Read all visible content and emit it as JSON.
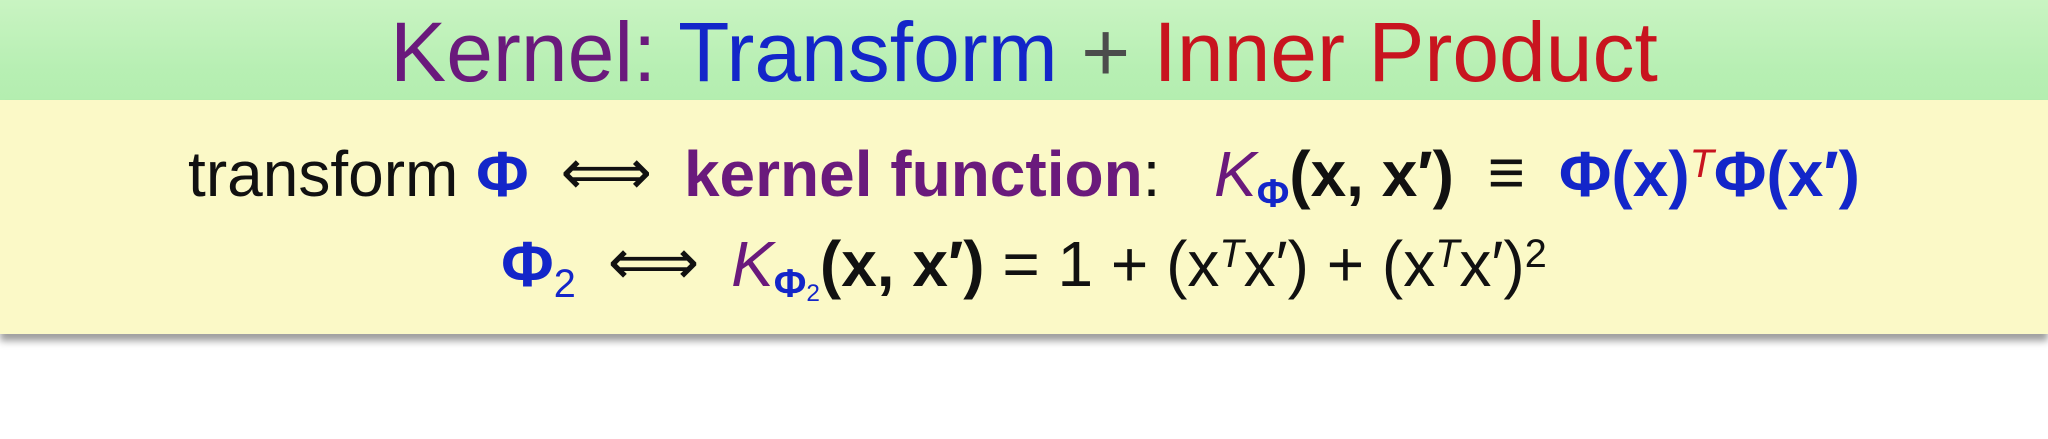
{
  "title": {
    "kernel": "Kernel:",
    "transform": "Transform",
    "plus": "+",
    "inner_product": "Inner Product"
  },
  "line1": {
    "transform_word": "transform",
    "phi": "Φ",
    "iff": "⟺",
    "kernel_function": "kernel function",
    "colon": ":",
    "K": "K",
    "K_sub": "Φ",
    "args": "(x, x′)",
    "equiv": "≡",
    "phi_x": "Φ(x)",
    "T": "T",
    "phi_xprime": "Φ(x′)"
  },
  "line2": {
    "phi": "Φ",
    "phi_sub": "2",
    "iff": "⟺",
    "K": "K",
    "K_sub": "Φ",
    "K_sub_sub": "2",
    "args": "(x, x′)",
    "rhs_part1": "= 1 + (x",
    "T1": "T",
    "rhs_part2": "x′) + (x",
    "T2": "T",
    "rhs_part3": "x′)",
    "square": "2"
  },
  "colors": {
    "title_band": "#b7efb3",
    "content_box": "#fbf9c7",
    "purple": "#6a1a7c",
    "blue": "#1326c9",
    "red": "#c8141f"
  }
}
